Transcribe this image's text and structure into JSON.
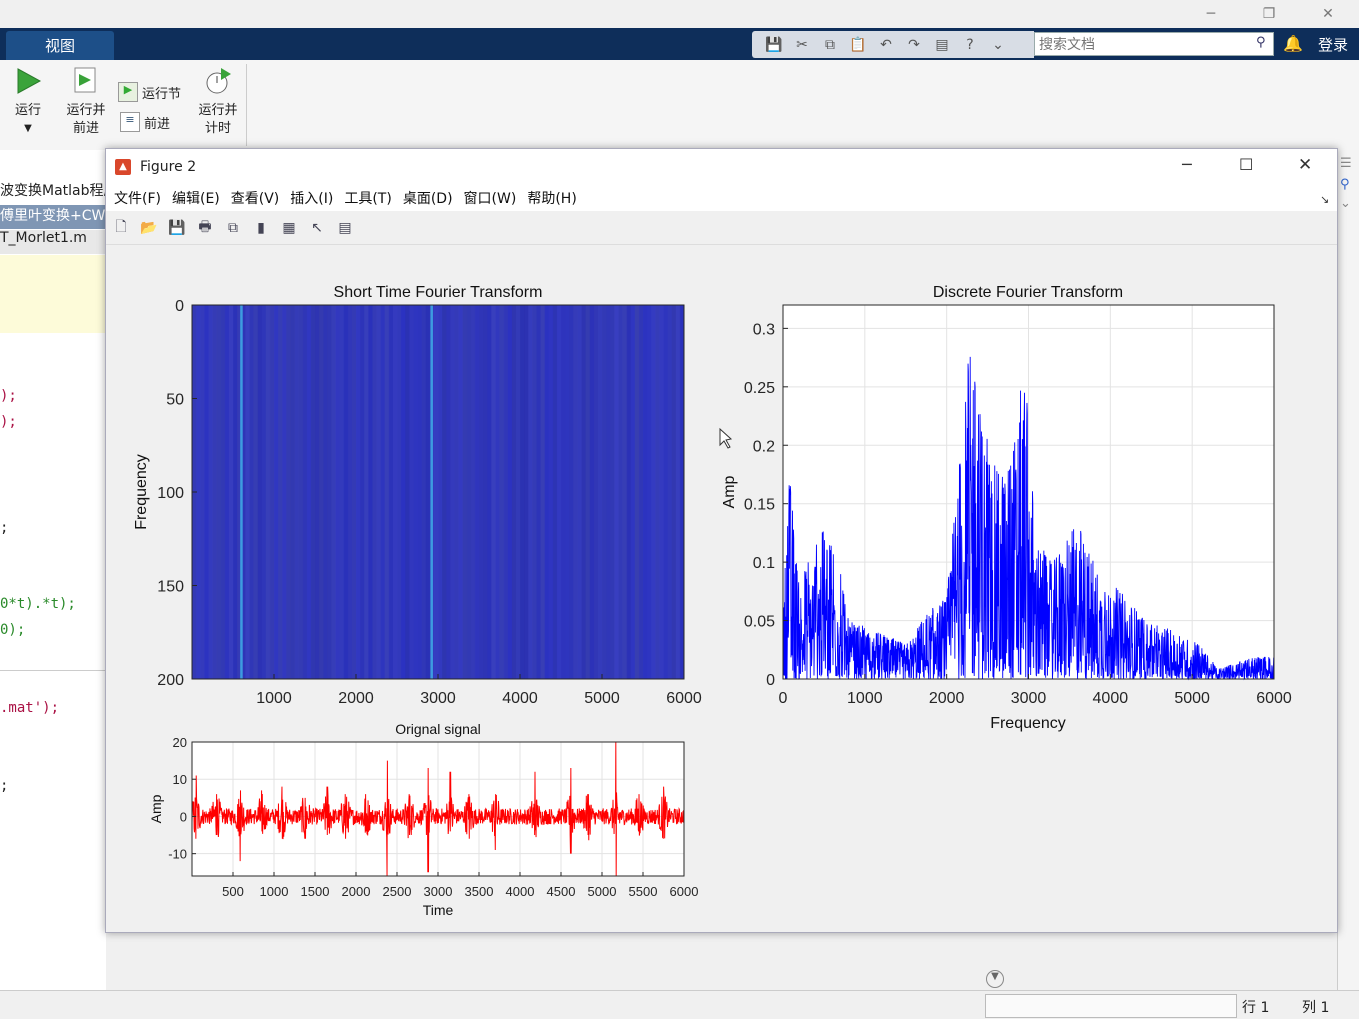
{
  "main": {
    "tab_view": "视图",
    "search_placeholder": "搜索文档",
    "login": "登录",
    "ribbon": {
      "run": "运行",
      "run_advance_1": "运行并",
      "run_advance_2": "前进",
      "run_section": "运行节",
      "advance": "前进",
      "run_time_1": "运行并",
      "run_time_2": "计时"
    },
    "editor_tabs": [
      "波变换Matlab程序",
      "傅里叶变换+CW",
      "T_Morlet1.m"
    ],
    "code_lines": [
      ");",
      ");",
      ";",
      "0*t).*t);",
      "0);",
      ".mat');",
      ";"
    ],
    "status_row": "行 1",
    "status_col": "列 1"
  },
  "figure": {
    "title": "Figure 2",
    "menu": [
      "文件(F)",
      "编辑(E)",
      "查看(V)",
      "插入(I)",
      "工具(T)",
      "桌面(D)",
      "窗口(W)",
      "帮助(H)"
    ]
  },
  "chart_data": [
    {
      "type": "heatmap",
      "title": "Short Time Fourier Transform",
      "xlabel": "",
      "ylabel": "Frequency",
      "xlim": [
        0,
        6000
      ],
      "ylim": [
        0,
        200
      ],
      "xticks": [
        1000,
        2000,
        3000,
        4000,
        5000,
        6000
      ],
      "yticks": [
        0,
        50,
        100,
        150,
        200
      ],
      "y_reversed": true,
      "bright_columns": [
        600,
        2920
      ],
      "colors": {
        "base": "#2f36b8",
        "highlight": "#3d9be0"
      }
    },
    {
      "type": "line",
      "title": "Orignal signal",
      "xlabel": "Time",
      "ylabel": "Amp",
      "xlim": [
        0,
        6000
      ],
      "ylim": [
        -16,
        20
      ],
      "xticks": [
        500,
        1000,
        1500,
        2000,
        2500,
        3000,
        3500,
        4000,
        4500,
        5000,
        5500,
        6000
      ],
      "yticks": [
        20,
        10,
        0,
        -10
      ],
      "color": "#ff0000",
      "grid": true,
      "spikes": [
        {
          "x": 50,
          "hi": 11,
          "lo": -6
        },
        {
          "x": 300,
          "hi": 6,
          "lo": -5
        },
        {
          "x": 590,
          "hi": 7,
          "lo": -12
        },
        {
          "x": 850,
          "hi": 7,
          "lo": -4
        },
        {
          "x": 1100,
          "hi": 8,
          "lo": -6
        },
        {
          "x": 1380,
          "hi": 5,
          "lo": -6
        },
        {
          "x": 1650,
          "hi": 8,
          "lo": -5
        },
        {
          "x": 1870,
          "hi": 6,
          "lo": -6
        },
        {
          "x": 2120,
          "hi": 6,
          "lo": -4
        },
        {
          "x": 2380,
          "hi": 15,
          "lo": -16
        },
        {
          "x": 2650,
          "hi": 6,
          "lo": -5
        },
        {
          "x": 2880,
          "hi": 13,
          "lo": -15
        },
        {
          "x": 3150,
          "hi": 12,
          "lo": -4
        },
        {
          "x": 3380,
          "hi": 6,
          "lo": -6
        },
        {
          "x": 3700,
          "hi": 6,
          "lo": -9
        },
        {
          "x": 4180,
          "hi": 12,
          "lo": -5
        },
        {
          "x": 4620,
          "hi": 13,
          "lo": -10
        },
        {
          "x": 4830,
          "hi": 6,
          "lo": -5
        },
        {
          "x": 5170,
          "hi": 20,
          "lo": -16
        },
        {
          "x": 5450,
          "hi": 6,
          "lo": -4
        },
        {
          "x": 5750,
          "hi": 8,
          "lo": -6
        }
      ]
    },
    {
      "type": "line",
      "title": "Discrete Fourier Transform",
      "xlabel": "Frequency",
      "ylabel": "Amp",
      "xlim": [
        0,
        6000
      ],
      "ylim": [
        0,
        0.32
      ],
      "xticks": [
        0,
        1000,
        2000,
        3000,
        4000,
        5000,
        6000
      ],
      "yticks": [
        0,
        0.05,
        0.1,
        0.15,
        0.2,
        0.25,
        0.3
      ],
      "color": "#0000ff",
      "grid": true,
      "envelope": [
        [
          0,
          0.05
        ],
        [
          70,
          0.19
        ],
        [
          200,
          0.08
        ],
        [
          400,
          0.12
        ],
        [
          600,
          0.14
        ],
        [
          800,
          0.05
        ],
        [
          1200,
          0.04
        ],
        [
          1500,
          0.03
        ],
        [
          1800,
          0.06
        ],
        [
          2000,
          0.07
        ],
        [
          2100,
          0.16
        ],
        [
          2250,
          0.26
        ],
        [
          2300,
          0.32
        ],
        [
          2400,
          0.24
        ],
        [
          2600,
          0.18
        ],
        [
          2800,
          0.2
        ],
        [
          2950,
          0.27
        ],
        [
          3100,
          0.12
        ],
        [
          3300,
          0.1
        ],
        [
          3600,
          0.14
        ],
        [
          3800,
          0.1
        ],
        [
          4200,
          0.07
        ],
        [
          4500,
          0.05
        ],
        [
          4800,
          0.04
        ],
        [
          5100,
          0.03
        ],
        [
          5300,
          0.01
        ],
        [
          5600,
          0.015
        ],
        [
          5800,
          0.02
        ],
        [
          6000,
          0.02
        ]
      ]
    }
  ]
}
